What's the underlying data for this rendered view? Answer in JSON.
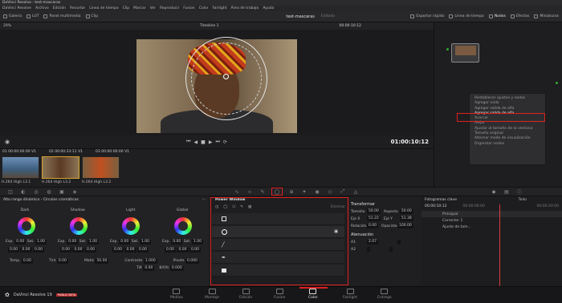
{
  "app": {
    "title": "DaVinci Resolve - test-mascaras"
  },
  "menu": [
    "DaVinci Resolve",
    "Archivo",
    "Edición",
    "Recortar",
    "Línea de tiempo",
    "Clip",
    "Marcar",
    "Ver",
    "Reproducir",
    "Fusion",
    "Color",
    "Fairlight",
    "Área de trabajo",
    "Ayuda"
  ],
  "toolbar": {
    "left": [
      "Galería",
      "LUT",
      "Panel multimedia",
      "Clip"
    ],
    "project": "test-mascaras",
    "status": "Editado",
    "right": [
      "Exportar rápido",
      "Línea de tiempo",
      "Nodos",
      "Efectos",
      "Miniaturas"
    ]
  },
  "viewer": {
    "zoom": "29%",
    "timeline": "Timeline 1",
    "timecode": "00:00:10:12",
    "clip_menu": "Clip",
    "playhead": "01:00:10:12"
  },
  "clips": [
    {
      "num": "01",
      "tc": "00:00:00:00",
      "track": "V1",
      "codec": "H.264 High L3.1"
    },
    {
      "num": "02",
      "tc": "00:00:33:11",
      "track": "V1",
      "codec": "H.264 High L3.2"
    },
    {
      "num": "03",
      "tc": "00:00:00:00",
      "track": "V1",
      "codec": "H.264 High L3.2"
    }
  ],
  "context_menu": {
    "items": [
      "Restablecer ajustes y nodos",
      "Agregar nodo",
      "Agregar salida de alfa",
      "Agregar salida de alfa",
      "Acercar",
      "Alejar",
      "Ajustar al tamaño de la ventana",
      "Tamaño original",
      "Alternar modo de visualización",
      "Organizar nodos"
    ],
    "highlighted": "Agregar salida de alfa"
  },
  "wheels": {
    "header": "Alto rango dinámico - Círculos cromáticos",
    "names": [
      "Dark",
      "Shadow",
      "Light",
      "Global"
    ],
    "values": [
      "0.00",
      "0.00",
      "0.00",
      "0.00"
    ],
    "exp": [
      "Exp.",
      "Sat."
    ],
    "exp_values": [
      "0.00",
      "1.00"
    ],
    "bottom_labels": [
      "Temp.",
      "Tint",
      "Matiz",
      "Contraste",
      "Pivote",
      "Tilt",
      "B/Ofs"
    ],
    "bottom_values": [
      "0.00",
      "0.00",
      "50.00",
      "1.000",
      "0.000",
      "0.00",
      "0.000"
    ]
  },
  "power_window": {
    "title": "Power Window",
    "eliminar": "Eliminar"
  },
  "transform": {
    "header": "Transformar",
    "rows": [
      {
        "a": "Tamaño",
        "av": "50.00",
        "b": "Aspecto",
        "bv": "50.00"
      },
      {
        "a": "Eje X",
        "av": "51.22",
        "b": "Eje Y",
        "bv": "51.38"
      },
      {
        "a": "Rotación",
        "av": "0.00",
        "b": "Opacidad",
        "bv": "100.00"
      }
    ],
    "atenuacion": "Atenuación",
    "att": [
      {
        "a": "A1",
        "av": "2.07",
        "b": "",
        "bv": ""
      },
      {
        "a": "A2",
        "av": "",
        "b": "",
        "bv": ""
      }
    ]
  },
  "keyframes": {
    "header": "Fotogramas clave",
    "filter": "Todo",
    "tc": "00:00:10:12",
    "ruler": [
      "00:00:00:00",
      "00:00:20:00"
    ],
    "tracks": [
      "Principal",
      "Corrector 1",
      "Ajuste de tam..."
    ]
  },
  "bottom": {
    "product": "DaVinci Resolve 19",
    "badge": "PUBLIC BETA",
    "tabs": [
      "Medios",
      "Montaje",
      "Edición",
      "Fusion",
      "Color",
      "Fairlight",
      "Entrega"
    ],
    "active": "Color"
  }
}
